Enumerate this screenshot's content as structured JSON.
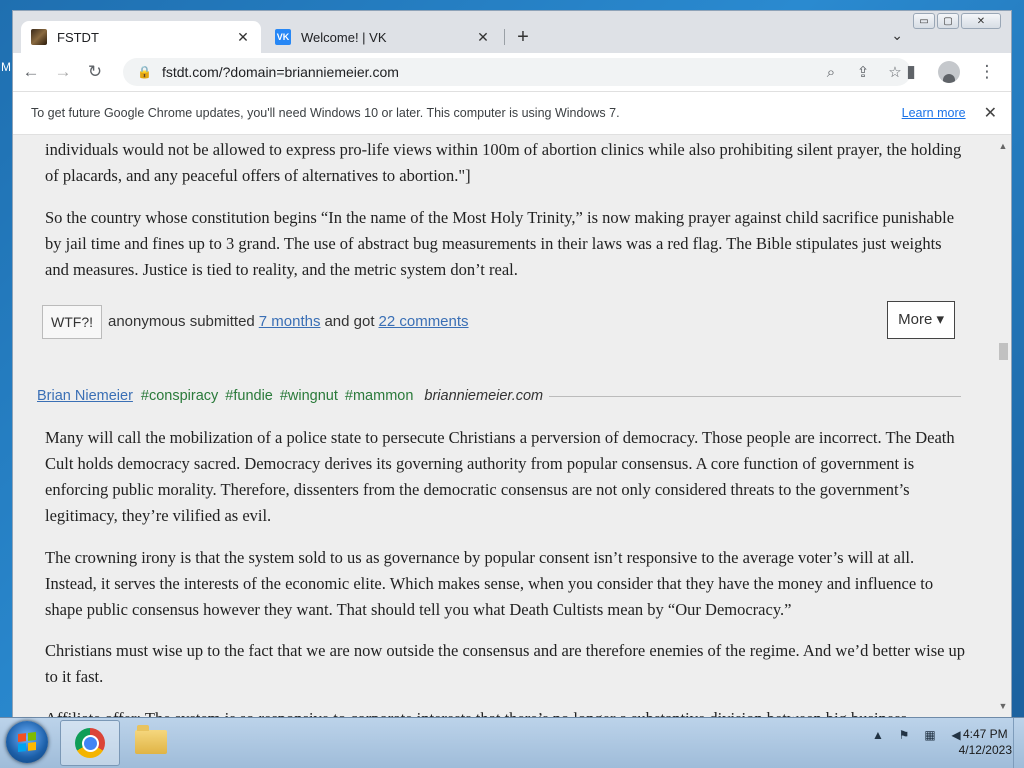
{
  "desktop": {
    "edge_letter": "M"
  },
  "window_controls": {
    "minimize": "▭",
    "maximize": "▢",
    "close": "✕"
  },
  "tabs": [
    {
      "title": "FSTDT",
      "active": true,
      "favicon": "fstdt-favicon",
      "close": "✕"
    },
    {
      "title": "Welcome! | VK",
      "active": false,
      "favicon": "vk-favicon",
      "favicon_text": "VK",
      "close": "✕"
    }
  ],
  "new_tab_label": "+",
  "tab_search_label": "⌄",
  "toolbar": {
    "back": "←",
    "forward": "→",
    "reload": "↻",
    "url": "fstdt.com/?domain=brianniemeier.com",
    "lock": "🔒",
    "zoom_icon": "⌕",
    "share_icon": "⇪",
    "star_icon": "☆",
    "sidepanel_icon": "▮",
    "menu_icon": "⋮"
  },
  "infobar": {
    "message": "To get future Google Chrome updates, you'll need Windows 10 or later. This computer is using Windows 7.",
    "learn_more": "Learn more",
    "close": "✕"
  },
  "content": {
    "para1": "individuals would not be allowed to express pro-life views within 100m of abortion clinics while also prohibiting silent prayer, the holding of placards, and any peaceful offers of alternatives to abortion.\"]",
    "para2": "So the country whose constitution begins “In the name of the Most Holy Trinity,” is now making prayer against child sacrifice punishable by jail time and fines up to 3 grand. The use of abstract bug measurements in their laws was a red flag. The Bible stipulates just weights and measures. Justice is tied to reality, and the metric system don’t real.",
    "meta": {
      "wtf": "WTF?!",
      "submitted_prefix": "anonymous submitted",
      "time_link": "7 months",
      "middle": "and got",
      "comments_link": "22 comments",
      "more": "More ▾"
    },
    "entry2": {
      "author": "Brian Niemeier",
      "tags": [
        "#conspiracy",
        "#fundie",
        "#wingnut",
        "#mammon"
      ],
      "domain": "brianniemeier.com"
    },
    "para3": "Many will call the mobilization of a police state to persecute Christians a perversion of democracy. Those people are incorrect. The Death Cult holds democracy sacred. Democracy derives its governing authority from popular consensus. A core function of government is enforcing public morality. Therefore, dissenters from the democratic consensus are not only considered threats to the government’s legitimacy, they’re vilified as evil.",
    "para4": "The crowning irony is that the system sold to us as governance by popular consent isn’t responsive to the average voter’s will at all. Instead, it serves the interests of the economic elite. Which makes sense, when you consider that they have the money and influence to shape public consensus however they want. That should tell you what Death Cultists mean by “Our Democracy.”",
    "para5": "Christians must wise up to the fact that we are now outside the consensus and are therefore enemies of the regime. And we’d better wise up to it fast.",
    "para6": "Affiliate offer: The system is so responsive to corporate interests that there’s no longer a substantive division between big business"
  },
  "taskbar": {
    "tray_up": "▲",
    "clock_time": "4:47 PM",
    "clock_date": "4/12/2023"
  },
  "colors": {
    "link": "#3a6fb5",
    "tag": "#2a7a3a",
    "page_bg": "#eeeeee",
    "chrome_blue": "#1a73e8"
  }
}
